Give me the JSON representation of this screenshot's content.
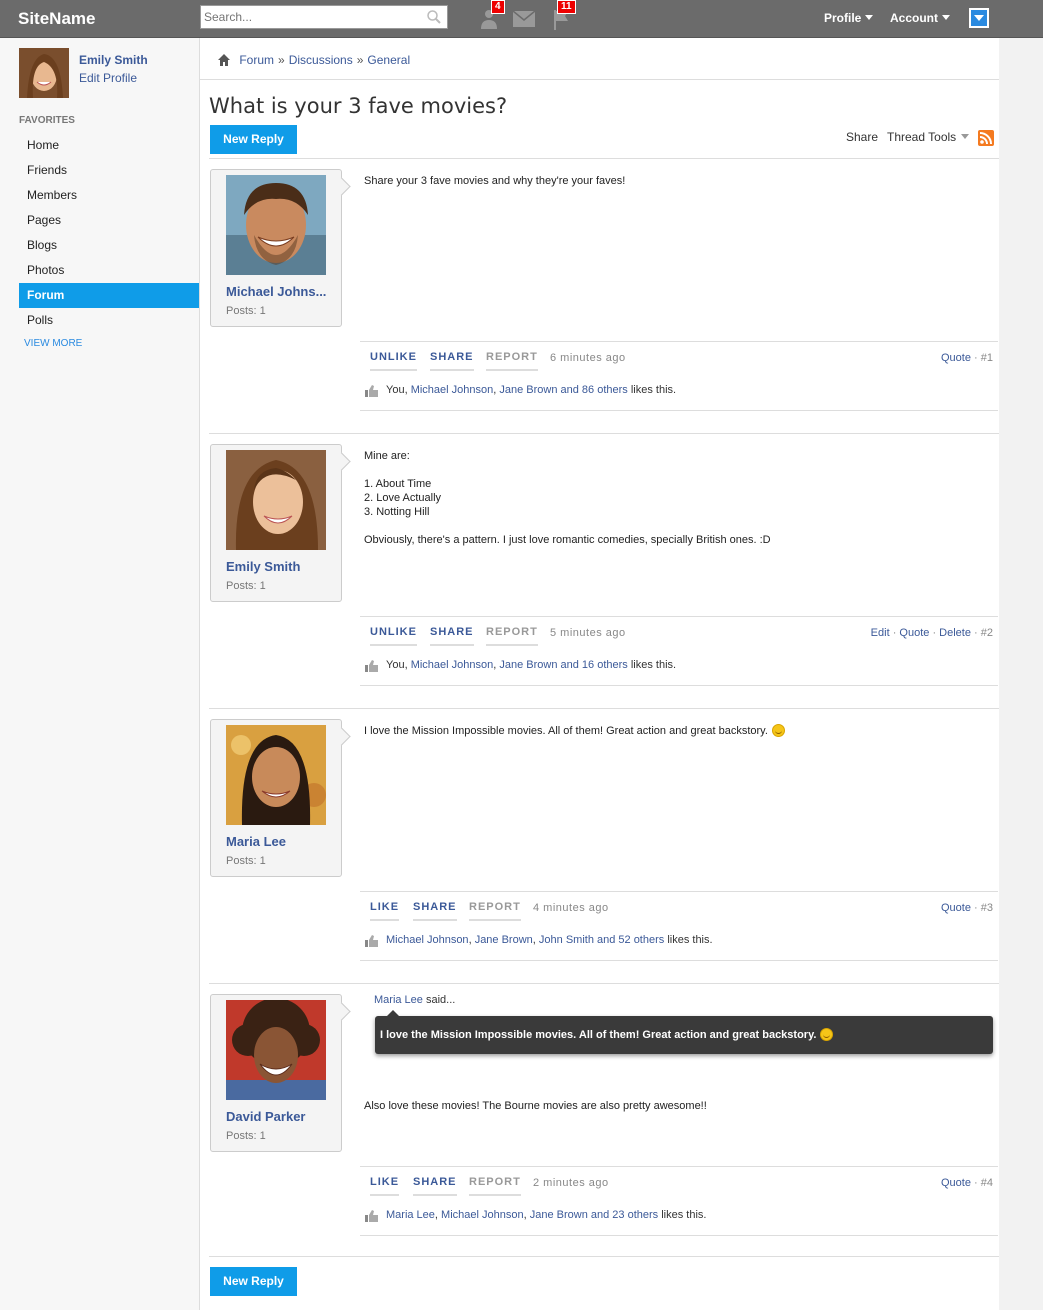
{
  "topbar": {
    "site_name": "SiteName",
    "search_placeholder": "Search...",
    "friend_requests_count": "4",
    "notifications_count": "11",
    "profile_label": "Profile",
    "account_label": "Account"
  },
  "sidebar": {
    "user_name": "Emily Smith",
    "edit_profile": "Edit Profile",
    "favorites_heading": "FAVORITES",
    "items": [
      {
        "label": "Home"
      },
      {
        "label": "Friends"
      },
      {
        "label": "Members"
      },
      {
        "label": "Pages"
      },
      {
        "label": "Blogs"
      },
      {
        "label": "Photos"
      },
      {
        "label": "Forum",
        "active": true
      },
      {
        "label": "Polls"
      }
    ],
    "view_more": "VIEW MORE"
  },
  "breadcrumb": {
    "items": [
      "Forum",
      "Discussions",
      "General"
    ]
  },
  "thread": {
    "title": "What is your 3 fave movies?",
    "new_reply_label": "New Reply",
    "share_label": "Share",
    "thread_tools_label": "Thread Tools"
  },
  "posts": [
    {
      "author": "Michael Johns...",
      "posts_count": "Posts: 1",
      "body": [
        "Share your 3 fave movies and why they're your faves!"
      ],
      "like_btn": "UNLIKE",
      "share_btn": "SHARE",
      "report_btn": "REPORT",
      "time": "6 minutes ago",
      "quote": "Quote",
      "number": "#1",
      "likes_prefix": "You, ",
      "likes_names": "Michael Johnson",
      "likes_sep": ", ",
      "likes_more": "Jane Brown and 86 others",
      "likes_suffix": " likes this."
    },
    {
      "author": "Emily Smith",
      "posts_count": "Posts: 1",
      "body_intro": "Mine are:",
      "body_list": [
        "1. About Time",
        "2. Love Actually",
        "3. Notting Hill"
      ],
      "body_outro": "Obviously, there's a pattern. I just love romantic comedies, specially British ones. :D",
      "like_btn": "UNLIKE",
      "share_btn": "SHARE",
      "report_btn": "REPORT",
      "time": "5 minutes ago",
      "edit": "Edit",
      "quote": "Quote",
      "delete": "Delete",
      "number": "#2",
      "likes_prefix": "You, ",
      "likes_names": "Michael Johnson",
      "likes_sep": ", ",
      "likes_more": "Jane Brown and 16 others",
      "likes_suffix": " likes this."
    },
    {
      "author": "Maria Lee",
      "posts_count": "Posts: 1",
      "body": "I love the Mission Impossible movies. All of them! Great action and great backstory.",
      "like_btn": "LIKE",
      "share_btn": "SHARE",
      "report_btn": "REPORT",
      "time": "4 minutes ago",
      "quote": "Quote",
      "number": "#3",
      "likes_names_1": "Michael Johnson",
      "likes_names_2": "Jane Brown",
      "likes_more": "John Smith and 52 others",
      "likes_suffix": " likes this."
    },
    {
      "author": "David Parker",
      "posts_count": "Posts: 1",
      "quote_author": "Maria Lee",
      "quote_said": " said...",
      "quote_text": "I love the Mission Impossible movies. All of them! Great action and great backstory.",
      "body": "Also love these movies! The Bourne movies are also pretty awesome!!",
      "like_btn": "LIKE",
      "share_btn": "SHARE",
      "report_btn": "REPORT",
      "time": "2 minutes ago",
      "quote": "Quote",
      "number": "#4",
      "likes_names_1": "Maria Lee",
      "likes_names_2": "Michael Johnson",
      "likes_more": "Jane Brown and 23 others",
      "likes_suffix": " likes this."
    }
  ],
  "colors": {
    "topbar": "#6b6b6b",
    "accent": "#0f9ce8",
    "link": "#3b5998",
    "badge": "#ee0000"
  }
}
